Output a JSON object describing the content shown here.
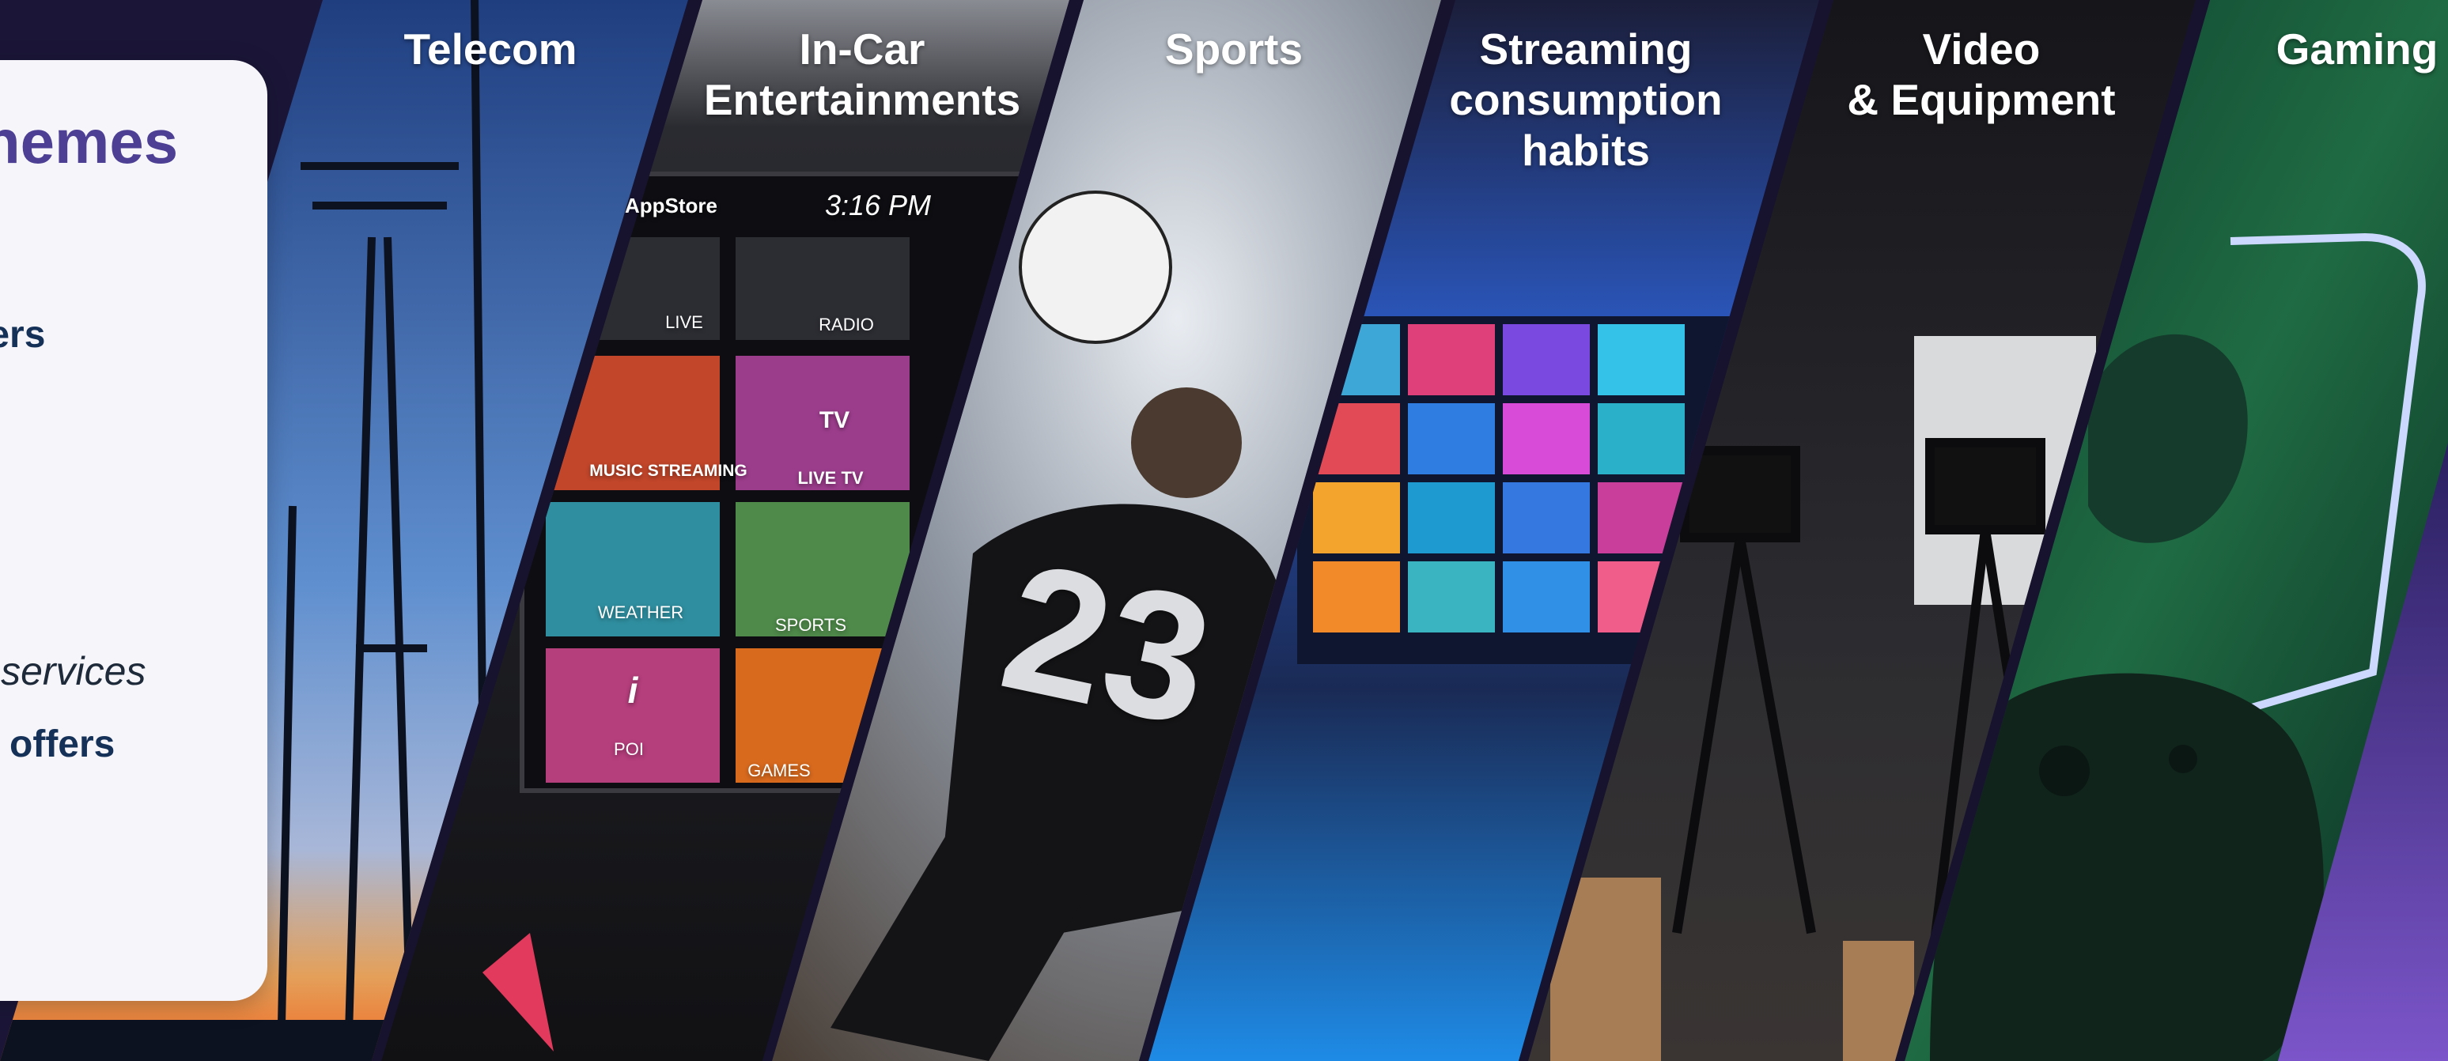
{
  "card": {
    "heading": "themes",
    "lines": [
      "ders",
      "y, services",
      "e) offers"
    ]
  },
  "panels": [
    {
      "label": "Telecom",
      "scene": "cell-tower-icon"
    },
    {
      "label": "In-Car\nEntertainments",
      "scene": "infotainment-screen-icon",
      "screen": {
        "store": "AppStore",
        "time": "3:16 PM",
        "tiles": [
          "LIVE",
          "RADIO",
          "MUSIC STREAMING",
          "LIVE TV",
          "WEATHER",
          "SPORTS",
          "POI",
          "GAMES"
        ],
        "tv_badge": "TV",
        "poi_glyph": "i"
      }
    },
    {
      "label": "Sports",
      "scene": "soccer-player-icon",
      "jersey_number": "23"
    },
    {
      "label": "Streaming\nconsumption\nhabits",
      "scene": "video-wall-icon"
    },
    {
      "label": "Video\n& Equipment",
      "scene": "camera-tripod-icon"
    },
    {
      "label": "Gaming",
      "scene": "game-controller-icon"
    }
  ],
  "colors": {
    "page_bg": "#1b1638",
    "card_bg": "#f6f6fa",
    "heading": "#4d3f93",
    "bold_text": "#163158",
    "separator": "#17132e",
    "gaming_green": "#1f6b43",
    "accent_purple": "#7b55c9"
  }
}
